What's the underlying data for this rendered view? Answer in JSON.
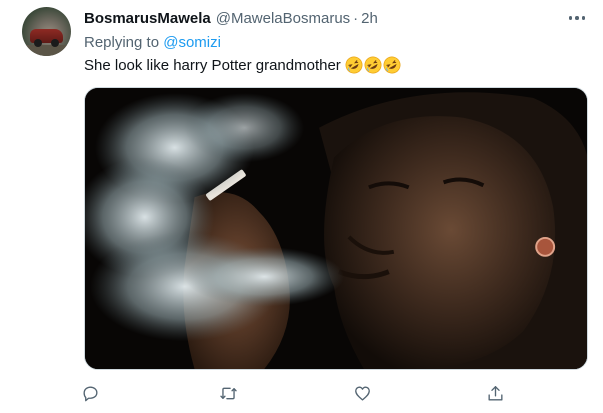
{
  "tweet": {
    "author_name": "BosmarusMawela",
    "author_handle": "@MawelaBosmarus",
    "separator": "·",
    "time": "2h",
    "replying_prefix": "Replying to ",
    "replying_to": "@somizi",
    "text": "She look like harry Potter grandmother",
    "emojis": [
      "rolling-on-floor-laughing-emoji",
      "rolling-on-floor-laughing-emoji",
      "rolling-on-floor-laughing-emoji"
    ]
  },
  "icons": {
    "more": "more-options-icon",
    "reply": "reply-icon",
    "retweet": "retweet-icon",
    "like": "heart-icon",
    "share": "share-icon"
  },
  "colors": {
    "link": "#1d9bf0",
    "secondary_text": "#536471",
    "primary_text": "#0f1419"
  }
}
